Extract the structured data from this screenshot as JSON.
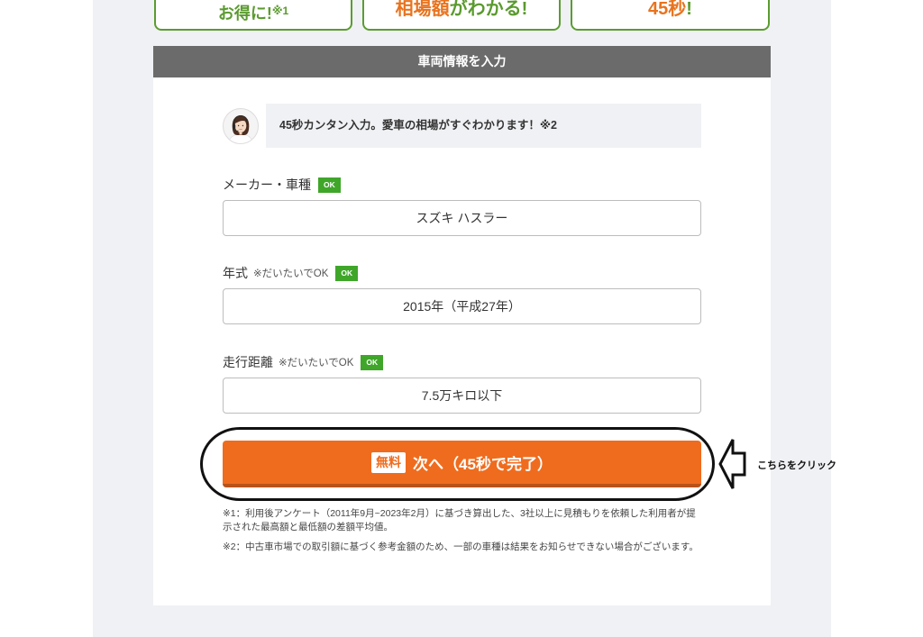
{
  "colors": {
    "accent_orange": "#ef6c1e",
    "brand_green": "#5a9a2e",
    "ok_badge_green": "#3fa62a",
    "header_gray": "#6b6b6b",
    "page_background": "#eff1f4"
  },
  "features": [
    {
      "text": "お得に!",
      "note": "※1"
    },
    {
      "highlight": "相場額",
      "text": "がわかる!"
    },
    {
      "highlight": "45秒",
      "text": "!"
    }
  ],
  "section_header": {
    "title": "車両情報を入力"
  },
  "intro": {
    "avatar_icon": "operator-avatar-icon",
    "message": "45秒カンタン入力。愛車の相場がすぐわかります！※2"
  },
  "fields": [
    {
      "label": "メーカー・車種",
      "badge": "OK",
      "value": "スズキ ハスラー"
    },
    {
      "label": "年式",
      "hint": "※だいたいでOK",
      "badge": "OK",
      "value": "2015年（平成27年）"
    },
    {
      "label": "走行距離",
      "hint": "※だいたいでOK",
      "badge": "OK",
      "value": "7.5万キロ以下"
    }
  ],
  "submit_button": {
    "badge": "無料",
    "label": "次へ（45秒で完了）"
  },
  "annotation": {
    "callout": "こちらをクリック",
    "arrow_icon": "arrow-left-icon"
  },
  "footnotes": [
    "※1：利用後アンケート（2011年9月~2023年2月）に基づき算出した、3社以上に見積もりを依頼した利用者が提示された最高額と最低額の差額平均値。",
    "※2：中古車市場での取引額に基づく参考金額のため、一部の車種は結果をお知らせできない場合がございます。"
  ]
}
